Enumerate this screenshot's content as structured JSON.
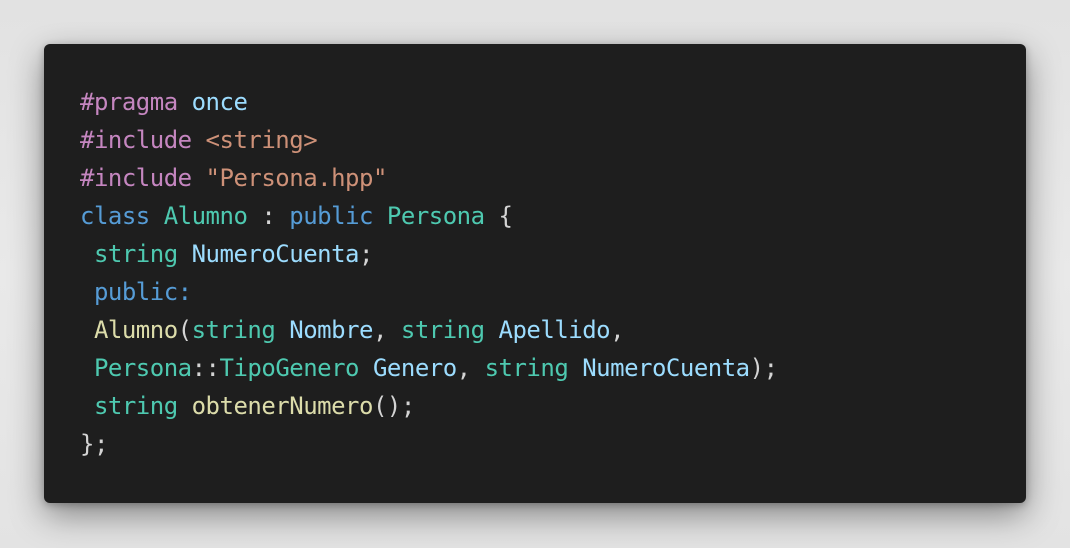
{
  "colors": {
    "background": "#e6e6e6",
    "editor_background": "#1e1e1e",
    "macro": "#c586c0",
    "keyword": "#569cd6",
    "type": "#4ec9b0",
    "string": "#ce9178",
    "variable": "#9cdcfe",
    "function": "#dcdcaa",
    "default": "#d4d4d4"
  },
  "code": {
    "lines": [
      [
        {
          "text": "#pragma",
          "kind": "macro"
        },
        {
          "text": " ",
          "kind": "plain"
        },
        {
          "text": "once",
          "kind": "var"
        }
      ],
      [
        {
          "text": "#include",
          "kind": "macro"
        },
        {
          "text": " ",
          "kind": "plain"
        },
        {
          "text": "<string>",
          "kind": "string"
        }
      ],
      [
        {
          "text": "#include",
          "kind": "macro"
        },
        {
          "text": " ",
          "kind": "plain"
        },
        {
          "text": "\"Persona.hpp\"",
          "kind": "string"
        }
      ],
      [
        {
          "text": "class",
          "kind": "keyword"
        },
        {
          "text": " ",
          "kind": "plain"
        },
        {
          "text": "Alumno",
          "kind": "type"
        },
        {
          "text": " : ",
          "kind": "plain"
        },
        {
          "text": "public",
          "kind": "keyword"
        },
        {
          "text": " ",
          "kind": "plain"
        },
        {
          "text": "Persona",
          "kind": "type"
        },
        {
          "text": " {",
          "kind": "plain"
        }
      ],
      [
        {
          "text": " ",
          "kind": "plain"
        },
        {
          "text": "string",
          "kind": "type"
        },
        {
          "text": " ",
          "kind": "plain"
        },
        {
          "text": "NumeroCuenta",
          "kind": "var"
        },
        {
          "text": ";",
          "kind": "plain"
        }
      ],
      [
        {
          "text": " ",
          "kind": "plain"
        },
        {
          "text": "public:",
          "kind": "keyword"
        }
      ],
      [
        {
          "text": " ",
          "kind": "plain"
        },
        {
          "text": "Alumno",
          "kind": "func"
        },
        {
          "text": "(",
          "kind": "plain"
        },
        {
          "text": "string",
          "kind": "type"
        },
        {
          "text": " ",
          "kind": "plain"
        },
        {
          "text": "Nombre",
          "kind": "var"
        },
        {
          "text": ", ",
          "kind": "plain"
        },
        {
          "text": "string",
          "kind": "type"
        },
        {
          "text": " ",
          "kind": "plain"
        },
        {
          "text": "Apellido",
          "kind": "var"
        },
        {
          "text": ",",
          "kind": "plain"
        }
      ],
      [
        {
          "text": " ",
          "kind": "plain"
        },
        {
          "text": "Persona",
          "kind": "type"
        },
        {
          "text": "::",
          "kind": "plain"
        },
        {
          "text": "TipoGenero",
          "kind": "type"
        },
        {
          "text": " ",
          "kind": "plain"
        },
        {
          "text": "Genero",
          "kind": "var"
        },
        {
          "text": ", ",
          "kind": "plain"
        },
        {
          "text": "string",
          "kind": "type"
        },
        {
          "text": " ",
          "kind": "plain"
        },
        {
          "text": "NumeroCuenta",
          "kind": "var"
        },
        {
          "text": ");",
          "kind": "plain"
        }
      ],
      [
        {
          "text": " ",
          "kind": "plain"
        },
        {
          "text": "string",
          "kind": "type"
        },
        {
          "text": " ",
          "kind": "plain"
        },
        {
          "text": "obtenerNumero",
          "kind": "func"
        },
        {
          "text": "();",
          "kind": "plain"
        }
      ],
      [
        {
          "text": "};",
          "kind": "plain"
        }
      ]
    ]
  }
}
